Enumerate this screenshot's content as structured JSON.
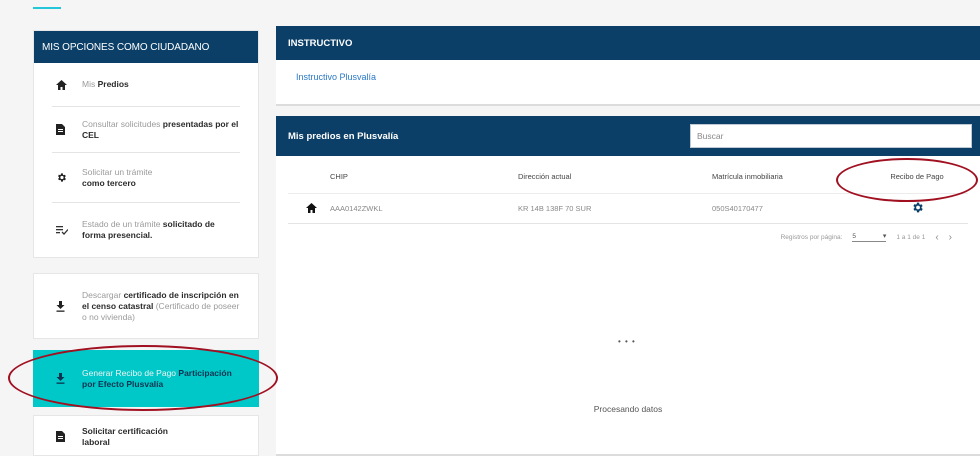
{
  "sidebar": {
    "header": "MIS OPCIONES COMO CIUDADANO",
    "items": [
      {
        "icon": "home-icon",
        "light": "Mis ",
        "bold": "Predios"
      },
      {
        "icon": "document-icon",
        "light": "Consultar solicitudes ",
        "bold": "presentadas por el CEL"
      },
      {
        "icon": "gear-icon",
        "light": "Solicitar un trámite",
        "bold": "como tercero"
      },
      {
        "icon": "checklist-icon",
        "light": "Estado de un trámite ",
        "bold": "solicitado de forma presencial."
      }
    ],
    "download_cert": {
      "icon": "download-icon",
      "light": "Descargar ",
      "bold": "certificado de inscripción en el censo catastral",
      "tail": " (Certificado de poseer o no vivienda)"
    },
    "generate_receipt": {
      "icon": "download-icon",
      "light": "Generar Recibo de Pago ",
      "bold": "Participación por Efecto Plusvalía"
    },
    "labor_cert": {
      "icon": "document-icon",
      "bold": "Solicitar certificación laboral"
    }
  },
  "instructivo": {
    "title": "INSTRUCTIVO",
    "link": "Instructivo Plusvalía"
  },
  "predios": {
    "title": "Mis predios en Plusvalía",
    "search_placeholder": "Buscar",
    "columns": [
      "CHIP",
      "Dirección actual",
      "Matrícula inmobiliaria",
      "Recibo de Pago"
    ],
    "rows": [
      {
        "chip": "AAA0142ZWKL",
        "direccion": "KR 14B 138F 70 SUR",
        "matricula": "050S40170477"
      }
    ],
    "pager": {
      "label": "Registros por página:",
      "size": "5",
      "range": "1 a 1 de 1",
      "prev": "‹",
      "next": "›"
    },
    "spinner": "• • •",
    "processing": "Procesando datos"
  },
  "colors": {
    "navy": "#0c3f67",
    "teal": "#00c8c8",
    "annotation": "#a01020"
  }
}
